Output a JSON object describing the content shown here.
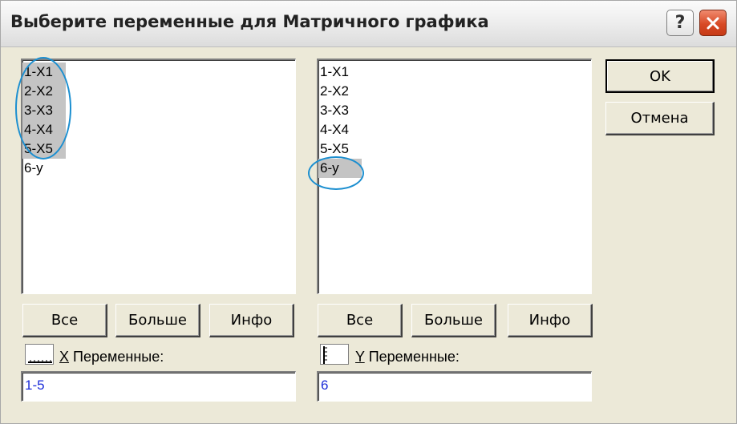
{
  "window": {
    "title": "Выберите переменные для Матричного графика"
  },
  "titlebar_buttons": {
    "help_label": "?"
  },
  "left_list": {
    "items": [
      {
        "label": "1-X1",
        "selected": true
      },
      {
        "label": "2-X2",
        "selected": true
      },
      {
        "label": "3-X3",
        "selected": true
      },
      {
        "label": "4-X4",
        "selected": true
      },
      {
        "label": "5-X5",
        "selected": true
      },
      {
        "label": "6-y",
        "selected": false
      }
    ],
    "buttons": {
      "all": "Все",
      "more": "Больше",
      "info": "Инфо"
    },
    "variables_hotkey": "X",
    "variables_label": " Переменные:",
    "field_value": "1-5"
  },
  "right_list": {
    "items": [
      {
        "label": "1-X1",
        "selected": false
      },
      {
        "label": "2-X2",
        "selected": false
      },
      {
        "label": "3-X3",
        "selected": false
      },
      {
        "label": "4-X4",
        "selected": false
      },
      {
        "label": "5-X5",
        "selected": false
      },
      {
        "label": "6-y",
        "selected": true
      }
    ],
    "buttons": {
      "all": "Все",
      "more": "Больше",
      "info": "Инфо"
    },
    "variables_hotkey": "Y",
    "variables_label": " Переменные:",
    "field_value": "6"
  },
  "actions": {
    "ok": "OK",
    "cancel": "Отмена"
  },
  "colors": {
    "selection": "#c4c4c4",
    "field_text": "#1a2bd8",
    "annotation": "#1c8fd0"
  }
}
